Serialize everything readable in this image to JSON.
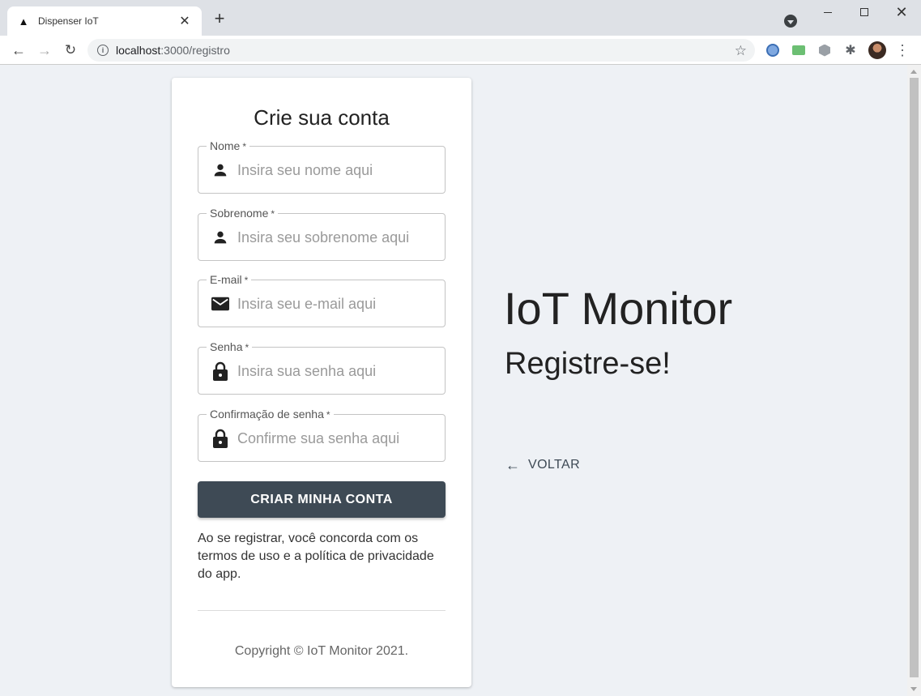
{
  "browser": {
    "tab_title": "Dispenser IoT",
    "url_host": "localhost",
    "url_path": ":3000/registro"
  },
  "form": {
    "title": "Crie sua conta",
    "fields": [
      {
        "label": "Nome",
        "required": "*",
        "placeholder": "Insira seu nome aqui",
        "icon": "person-icon"
      },
      {
        "label": "Sobrenome",
        "required": "*",
        "placeholder": "Insira seu sobrenome aqui",
        "icon": "person-icon"
      },
      {
        "label": "E-mail",
        "required": "*",
        "placeholder": "Insira seu e-mail aqui",
        "icon": "mail-icon"
      },
      {
        "label": "Senha",
        "required": "*",
        "placeholder": "Insira sua senha aqui",
        "icon": "lock-icon"
      },
      {
        "label": "Confirmação de senha",
        "required": "*",
        "placeholder": "Confirme sua senha aqui",
        "icon": "lock-icon"
      }
    ],
    "submit_label": "CRIAR MINHA CONTA",
    "terms_text": "Ao se registrar, você concorda com os termos de uso e a política de privacidade do app.",
    "copyright": "Copyright © IoT Monitor 2021."
  },
  "hero": {
    "title": "IoT Monitor",
    "subtitle": "Registre-se!",
    "back_label": "VOLTAR"
  },
  "colors": {
    "primary": "#3e4a55",
    "page_background": "#eef1f5",
    "card_background": "#ffffff"
  }
}
